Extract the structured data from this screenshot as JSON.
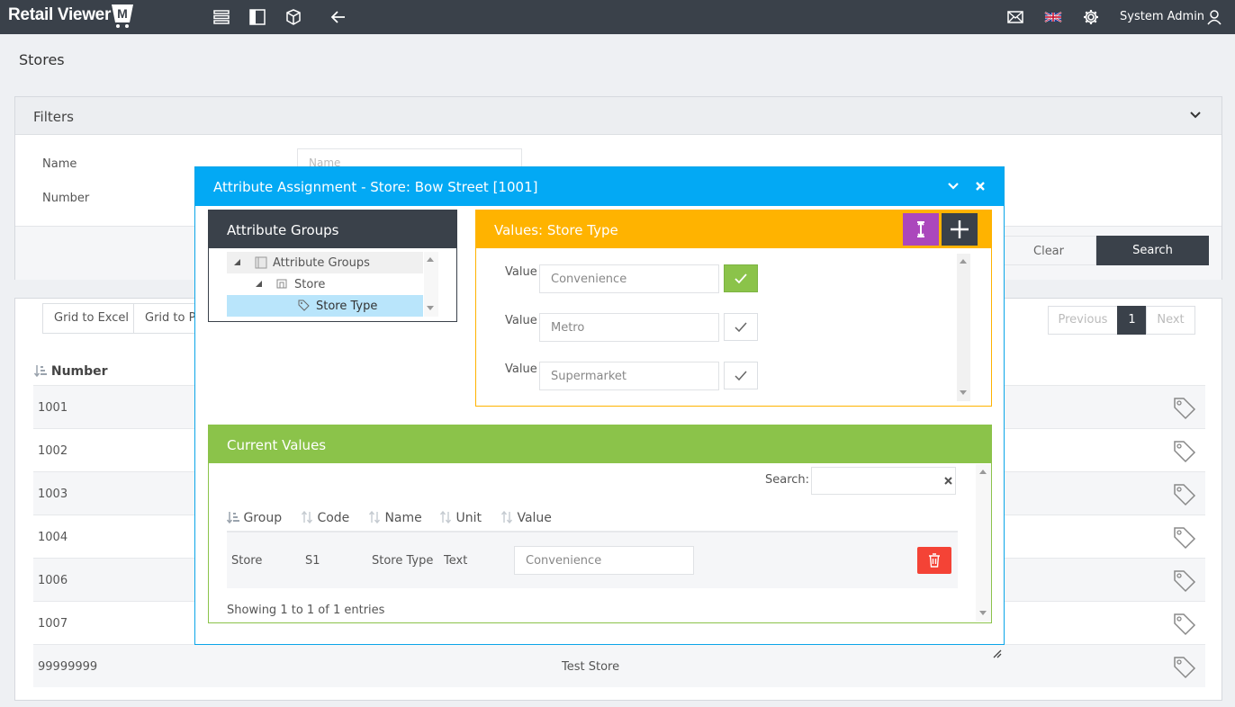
{
  "app": {
    "logo_text": "Retail Viewer",
    "logo_letter": "M",
    "user_name": "System Admin"
  },
  "topbar": {
    "icons": [
      "list-icon",
      "sidebar-icon",
      "cube-icon",
      "back-arrow-icon",
      "mail-icon",
      "uk-flag-icon",
      "gear-icon",
      "user-icon"
    ]
  },
  "page": {
    "title": "Stores"
  },
  "filters": {
    "title": "Filters",
    "name_label": "Name",
    "number_label": "Number",
    "name_placeholder": "Name",
    "clear_label": "Clear",
    "search_label": "Search"
  },
  "grid": {
    "export_excel": "Grid to Excel",
    "export_pdf": "Grid to Pl",
    "pager": {
      "previous": "Previous",
      "current": "1",
      "next": "Next"
    },
    "column_number": "Number",
    "rows": [
      {
        "number": "1001",
        "name": ""
      },
      {
        "number": "1002",
        "name": ""
      },
      {
        "number": "1003",
        "name": ""
      },
      {
        "number": "1004",
        "name": ""
      },
      {
        "number": "1006",
        "name": ""
      },
      {
        "number": "1007",
        "name": ""
      },
      {
        "number": "99999999",
        "name": "Test Store"
      }
    ]
  },
  "modal": {
    "title": "Attribute Assignment - Store: Bow Street [1001]",
    "attribute_groups": {
      "title": "Attribute Groups",
      "tree": [
        "Attribute Groups",
        "Store",
        "Store Type"
      ]
    },
    "values": {
      "title": "Values: Store Type",
      "label": "Value",
      "items": [
        {
          "value": "Convenience",
          "selected": true
        },
        {
          "value": "Metro",
          "selected": false
        },
        {
          "value": "Supermarket",
          "selected": false
        }
      ]
    },
    "current": {
      "title": "Current Values",
      "search_label": "Search:",
      "columns": [
        "Group",
        "Code",
        "Name",
        "Unit",
        "Value"
      ],
      "row": {
        "group": "Store",
        "code": "S1",
        "name": "Store Type",
        "unit": "Text",
        "value": "Convenience"
      },
      "info": "Showing 1 to 1 of 1 entries"
    }
  },
  "colors": {
    "topbar": "#3a414a",
    "modal_header": "#03a9f4",
    "values_header": "#ffb300",
    "current_header": "#8bc34a",
    "purple_button": "#ab47bc",
    "delete_button": "#f44336"
  }
}
